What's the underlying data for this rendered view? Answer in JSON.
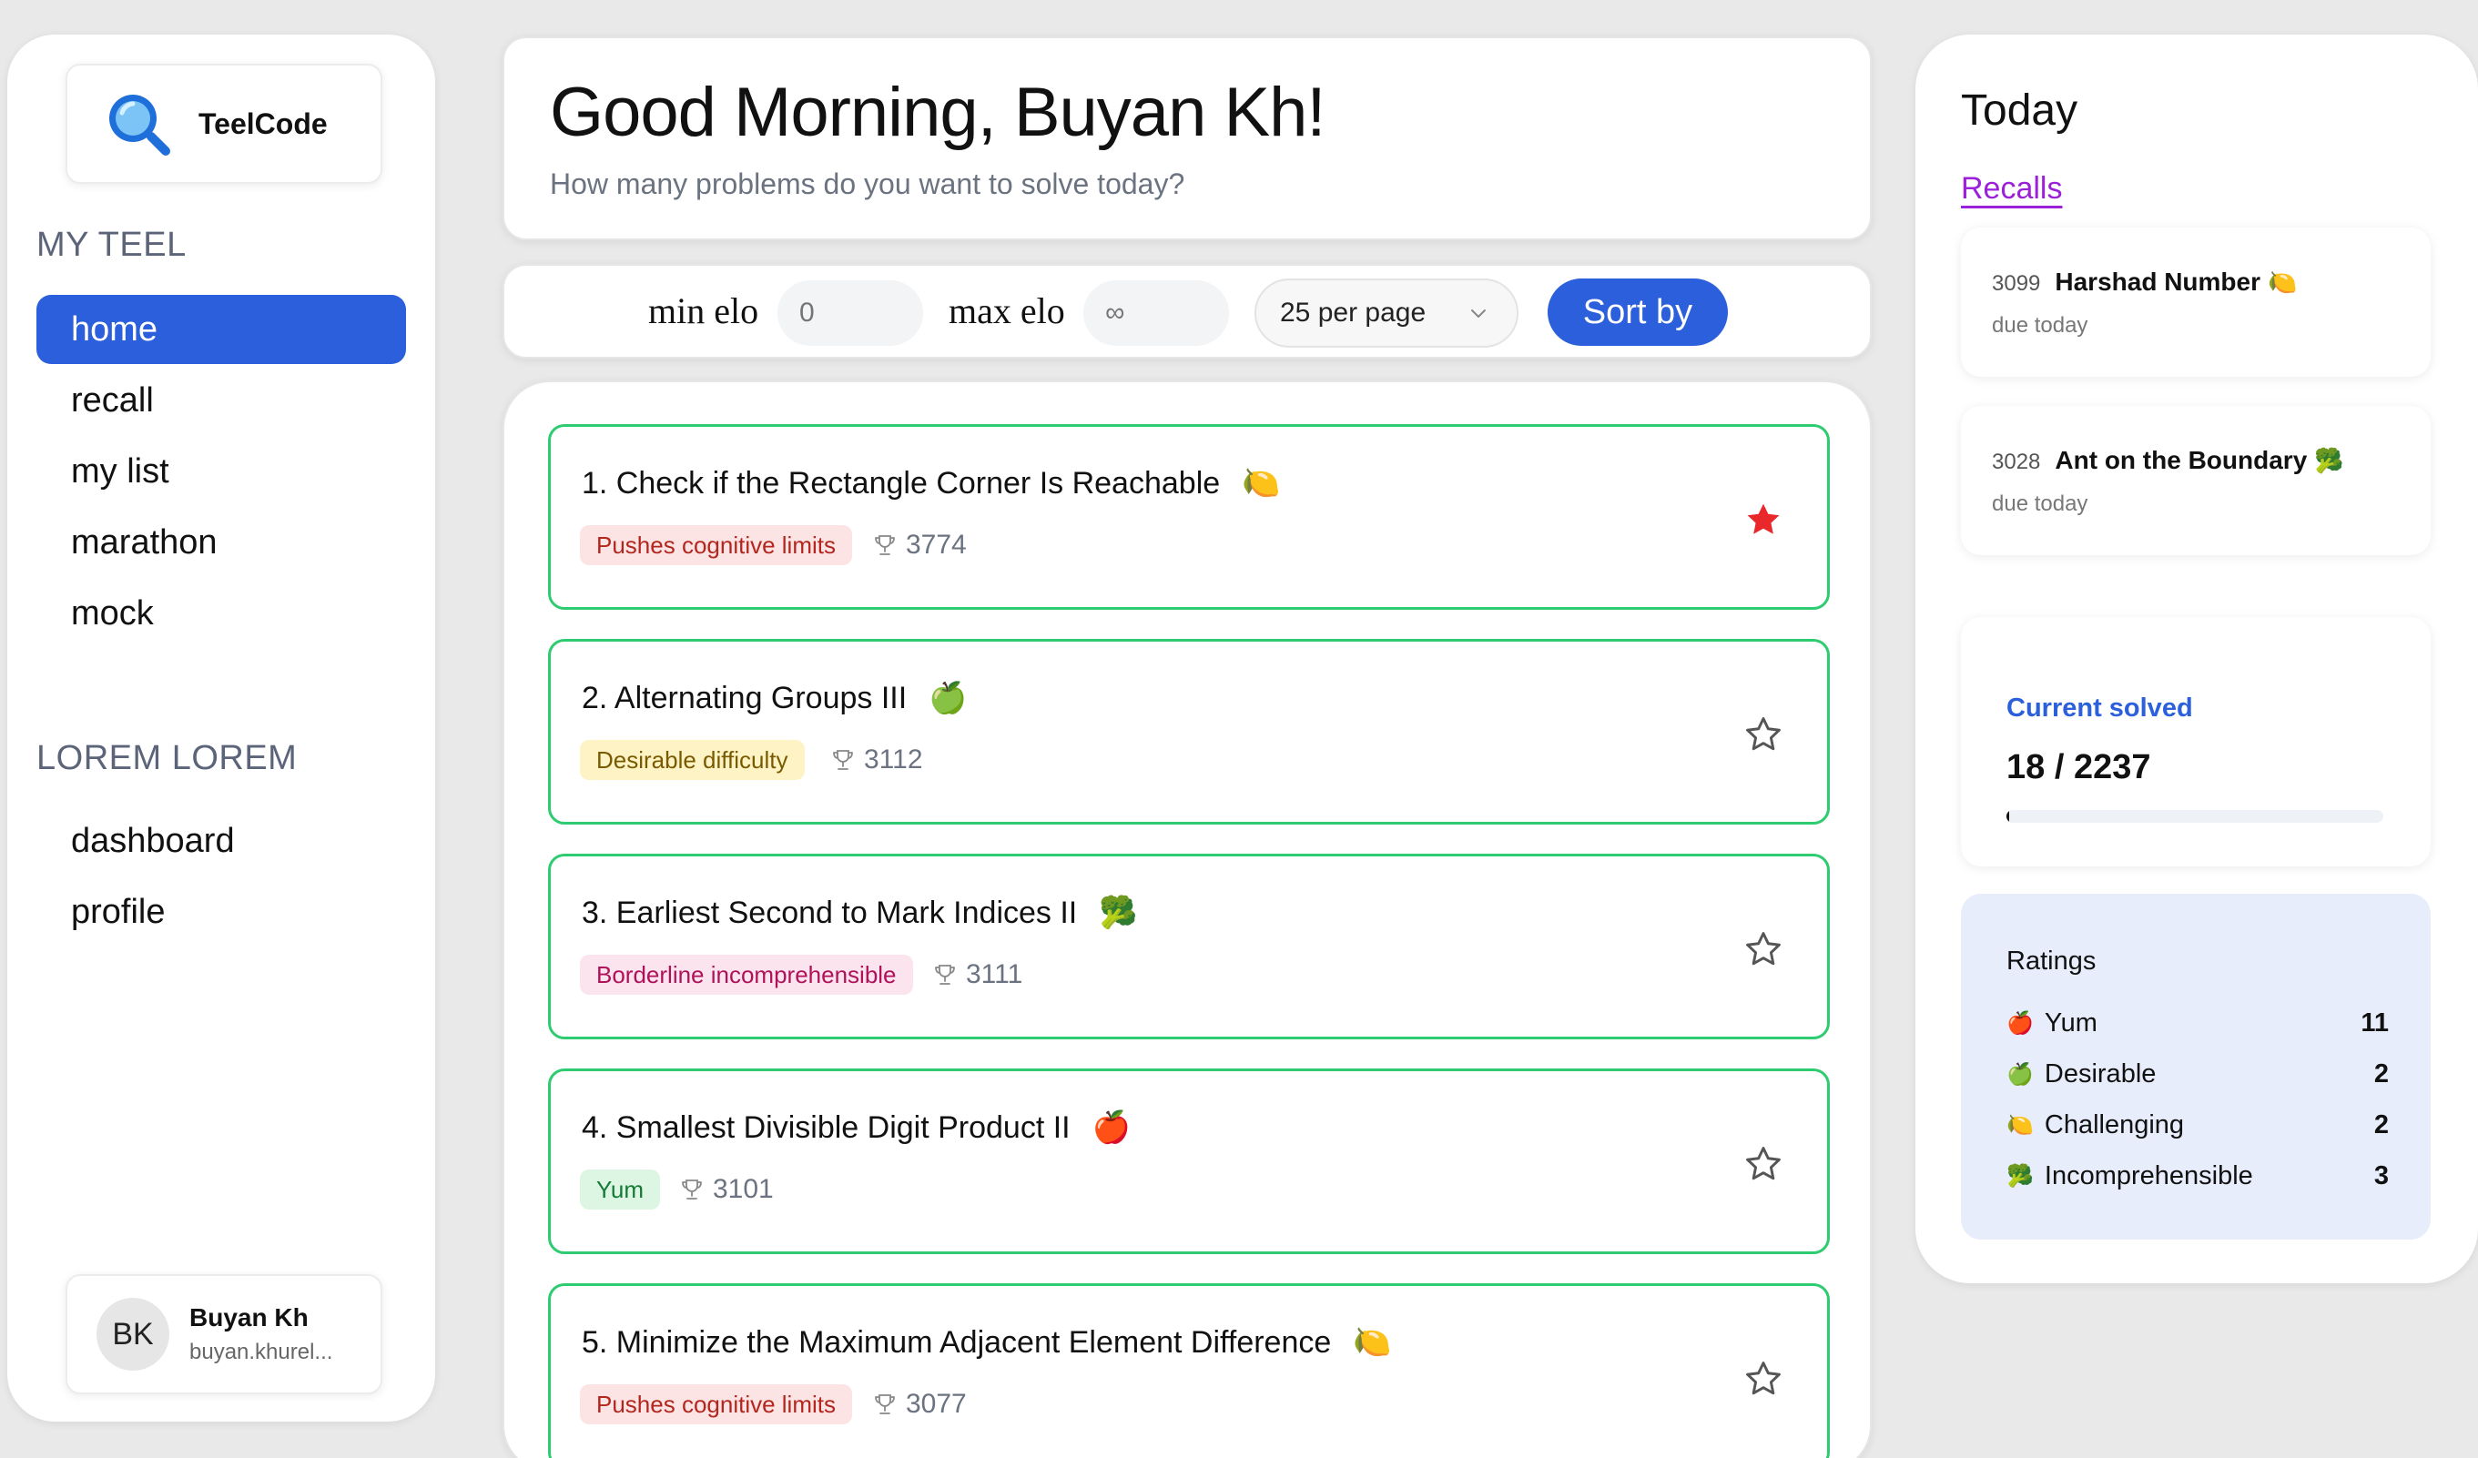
{
  "app": {
    "name": "TeelCode"
  },
  "sidebar": {
    "section1_title": "MY TEEL",
    "section1_items": [
      {
        "label": "home",
        "active": true
      },
      {
        "label": "recall",
        "active": false
      },
      {
        "label": "my list",
        "active": false
      },
      {
        "label": "marathon",
        "active": false
      },
      {
        "label": "mock",
        "active": false
      }
    ],
    "section2_title": "LOREM LOREM",
    "section2_items": [
      {
        "label": "dashboard"
      },
      {
        "label": "profile"
      }
    ],
    "user": {
      "initials": "BK",
      "name": "Buyan Kh",
      "email": "buyan.khurel..."
    }
  },
  "header": {
    "greeting": "Good Morning, Buyan Kh!",
    "subtitle": "How many problems do you want to solve today?"
  },
  "filters": {
    "min_label": "min elo",
    "min_placeholder": "0",
    "max_label": "max elo",
    "max_placeholder": "∞",
    "per_page": "25 per page",
    "sort_label": "Sort by"
  },
  "problems": [
    {
      "title": "1. Check if the Rectangle Corner Is Reachable",
      "emoji": "🍋",
      "tag": "Pushes cognitive limits",
      "tag_color": "red",
      "elo": "3774",
      "starred": true
    },
    {
      "title": "2. Alternating Groups III",
      "emoji": "🍏",
      "tag": "Desirable difficulty",
      "tag_color": "yellow",
      "elo": "3112",
      "starred": false
    },
    {
      "title": "3. Earliest Second to Mark Indices II",
      "emoji": "🥦",
      "tag": "Borderline incomprehensible",
      "tag_color": "pink",
      "elo": "3111",
      "starred": false
    },
    {
      "title": "4. Smallest Divisible Digit Product II",
      "emoji": "🍎",
      "tag": "Yum",
      "tag_color": "green",
      "elo": "3101",
      "starred": false
    },
    {
      "title": "5. Minimize the Maximum Adjacent Element Difference",
      "emoji": "🍋",
      "tag": "Pushes cognitive limits",
      "tag_color": "red",
      "elo": "3077",
      "starred": false
    }
  ],
  "today": {
    "title": "Today",
    "recalls_link": "Recalls",
    "recalls": [
      {
        "id": "3099",
        "name": "Harshad Number",
        "emoji": "🍋",
        "due": "due today"
      },
      {
        "id": "3028",
        "name": "Ant on the Boundary",
        "emoji": "🥦",
        "due": "due today"
      }
    ],
    "solved": {
      "title": "Current solved",
      "count": "18 / 2237",
      "fraction": 0.008
    },
    "ratings": {
      "title": "Ratings",
      "items": [
        {
          "emoji": "🍎",
          "label": "Yum",
          "count": "11"
        },
        {
          "emoji": "🍏",
          "label": "Desirable",
          "count": "2"
        },
        {
          "emoji": "🍋",
          "label": "Challenging",
          "count": "2"
        },
        {
          "emoji": "🥦",
          "label": "Incomprehensible",
          "count": "3"
        }
      ]
    }
  },
  "colors": {
    "accent": "#2b5fdb",
    "card_border": "#2ecc71",
    "recalls_link": "#9b20d9",
    "star_filled": "#e8282b"
  }
}
